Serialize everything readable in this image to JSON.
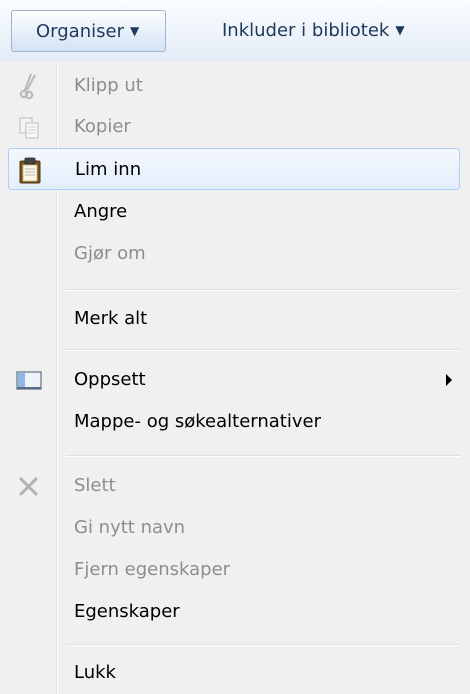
{
  "toolbar": {
    "organise_label": "Organiser",
    "include_label": "Inkluder i bibliotek",
    "dropdown_glyph": "▼"
  },
  "menu": {
    "items": [
      {
        "label": "Klipp ut",
        "icon": "scissors-icon",
        "enabled": false
      },
      {
        "label": "Kopier",
        "icon": "copy-icon",
        "enabled": false
      },
      {
        "label": "Lim inn",
        "icon": "clipboard-icon",
        "enabled": true,
        "highlighted": true
      },
      {
        "label": "Angre",
        "enabled": true
      },
      {
        "label": "Gjør om",
        "enabled": false
      },
      {
        "label": "Merk alt",
        "enabled": true
      },
      {
        "label": "Oppsett",
        "icon": "layout-icon",
        "enabled": true,
        "has_submenu": true
      },
      {
        "label": "Mappe- og søkealternativer",
        "enabled": true
      },
      {
        "label": "Slett",
        "icon": "delete-x-icon",
        "enabled": false
      },
      {
        "label": "Gi nytt navn",
        "enabled": false
      },
      {
        "label": "Fjern egenskaper",
        "enabled": false
      },
      {
        "label": "Egenskaper",
        "enabled": true
      },
      {
        "label": "Lukk",
        "enabled": true
      }
    ]
  },
  "colors": {
    "menu_background": "#f0f0f0",
    "disabled_text": "#8d8d8d",
    "toolbar_text": "#1e395b",
    "highlight_border": "#aecff7"
  }
}
